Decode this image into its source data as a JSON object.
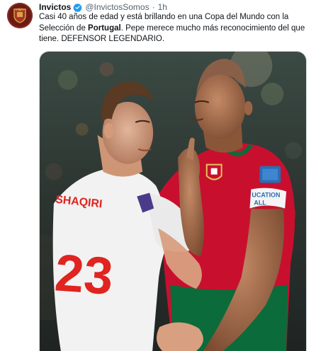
{
  "tweet": {
    "author_name": "Invictos",
    "handle": "@InvictosSomos",
    "separator": "·",
    "time": "1h",
    "text_part1": "Casi 40 años de edad y está brillando en una Copa del Mundo con la Selección de ",
    "text_bold": "Portugal",
    "text_part2": ". Pepe merece mucho más reconocimiento del que tiene. DEFENSOR LEGENDARIO.",
    "media": {
      "jersey_name": "SHAQIRI",
      "jersey_number": "23",
      "armband_text_1": "UCATION",
      "armband_text_2": "ALL",
      "colors": {
        "portugal_red": "#c8102e",
        "portugal_green": "#0b6b3a",
        "swiss_white": "#f2f2f2",
        "swiss_red": "#e0241f"
      }
    }
  },
  "icons": {
    "verified": "verified-badge-icon",
    "avatar": "invictos-logo-icon"
  }
}
